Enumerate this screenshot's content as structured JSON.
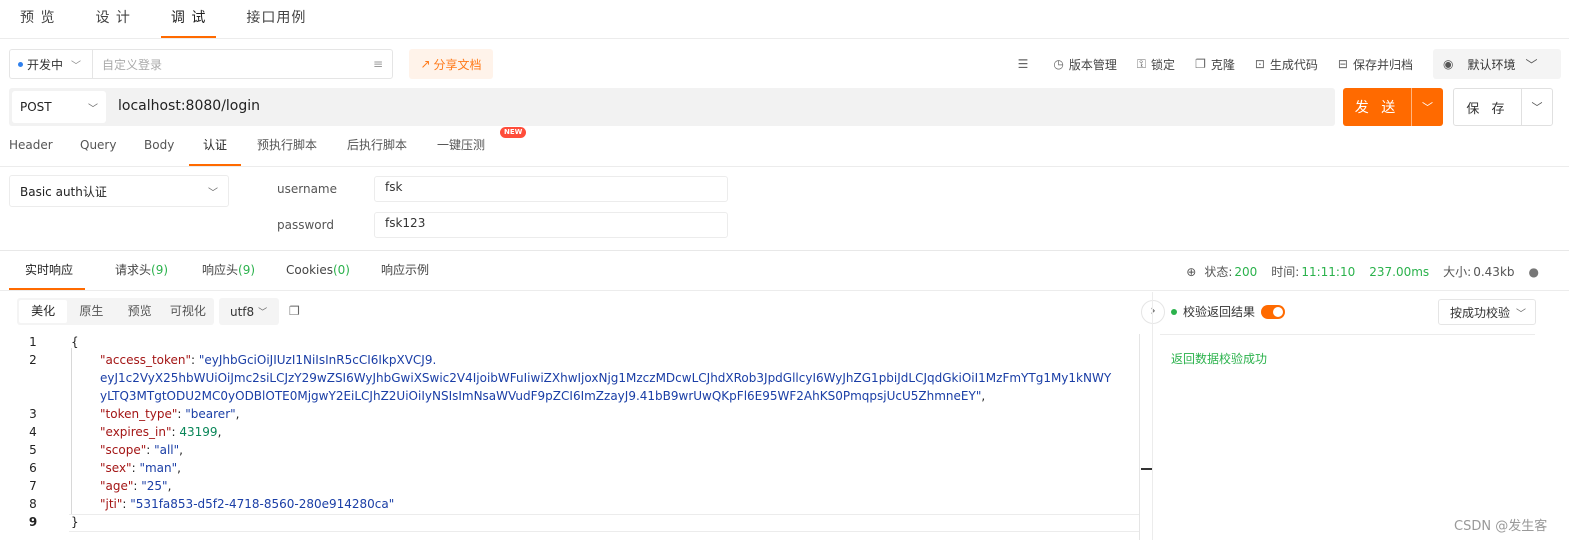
{
  "top_tabs": [
    "预 览",
    "设 计",
    "调 试",
    "接口用例"
  ],
  "env": {
    "selected": "开发中",
    "login_placeholder": "自定义登录",
    "share_label": "分享文档"
  },
  "toolbar": {
    "version": "版本管理",
    "lock": "锁定",
    "clone": "克隆",
    "gencode": "生成代码",
    "save_archive": "保存并归档",
    "environment": "默认环境"
  },
  "request": {
    "method": "POST",
    "url": "localhost:8080/login",
    "send_label": "发 送",
    "save_label": "保 存"
  },
  "req_tabs": [
    "Header",
    "Query",
    "Body",
    "认证",
    "预执行脚本",
    "后执行脚本",
    "一键压测"
  ],
  "new_badge": "NEW",
  "auth": {
    "type": "Basic auth认证",
    "username_label": "username",
    "username_value": "fsk",
    "password_label": "password",
    "password_value": "fsk123"
  },
  "resp_tabs": {
    "realtime": "实时响应",
    "req_headers": "请求头",
    "req_headers_count": "(9)",
    "resp_headers": "响应头",
    "resp_headers_count": "(9)",
    "cookies": "Cookies",
    "cookies_count": "(0)",
    "example": "响应示例"
  },
  "status": {
    "status_label": "状态:",
    "code": "200",
    "time_label": "时间:",
    "time": "11:11:10",
    "duration": "237.00ms",
    "size_label": "大小:",
    "size": "0.43kb"
  },
  "view_modes": [
    "美化",
    "原生",
    "预览",
    "可视化"
  ],
  "encoding": "utf8",
  "code": {
    "line_numbers": [
      "1",
      "2",
      "3",
      "4",
      "5",
      "6",
      "7",
      "8",
      "9"
    ],
    "open_brace": "{",
    "close_brace": "}",
    "access_token_key": "\"access_token\"",
    "access_token_l1": "\"eyJhbGciOiJIUzI1NiIsInR5cCI6IkpXVCJ9.",
    "access_token_l2": "eyJ1c2VyX25hbWUiOiJmc2siLCJzY29wZSI6WyJhbGwiXSwic2V4IjoibWFuIiwiZXhwIjoxNjg1MzczMDcwLCJhdXRob3JpdGllcyI6WyJhZG1pbiJdLCJqdGkiOiI1MzFmYTg1My1kNWY",
    "access_token_l3": "yLTQ3MTgtODU2MC0yODBlOTE0MjgwY2EiLCJhZ2UiOiIyNSIsImNsaWVudF9pZCI6ImZzayJ9.41bB9wrUwQKpFl6E95WF2AhKS0PmqpsjUcU5ZhmneEY\"",
    "token_type_key": "\"token_type\"",
    "token_type_val": "\"bearer\"",
    "expires_in_key": "\"expires_in\"",
    "expires_in_val": "43199",
    "scope_key": "\"scope\"",
    "scope_val": "\"all\"",
    "sex_key": "\"sex\"",
    "sex_val": "\"man\"",
    "age_key": "\"age\"",
    "age_val": "\"25\"",
    "jti_key": "\"jti\"",
    "jti_val": "\"531fa853-d5f2-4718-8560-280e914280ca\""
  },
  "validation": {
    "label": "校验返回结果",
    "mode": "按成功校验",
    "result": "返回数据校验成功"
  },
  "watermark": "CSDN @发生客"
}
